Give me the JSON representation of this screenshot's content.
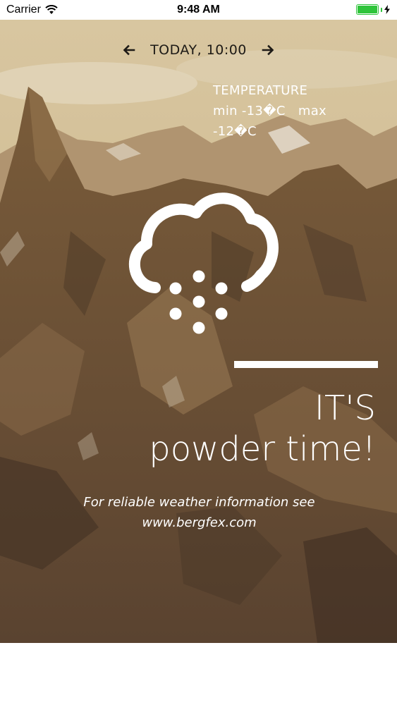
{
  "status_bar": {
    "carrier": "Carrier",
    "time": "9:48 AM",
    "wifi_icon": "wifi-icon",
    "battery_icon": "battery-icon",
    "charging_icon": "bolt-icon",
    "battery_color": "#2fc43b"
  },
  "date_nav": {
    "label": "TODAY, 10:00",
    "prev_icon": "arrow-left-icon",
    "next_icon": "arrow-right-icon"
  },
  "temperature": {
    "title": "TEMPERATURE",
    "min_label": "min",
    "min_value": "-13�C",
    "max_label": "max",
    "max_value": "-12�C"
  },
  "weather": {
    "icon": "cloud-snow-icon"
  },
  "headline": {
    "line1": "IT'S",
    "line2": "powder time!"
  },
  "info": {
    "text": "For reliable weather information see",
    "link": "www.bergfex.com"
  }
}
